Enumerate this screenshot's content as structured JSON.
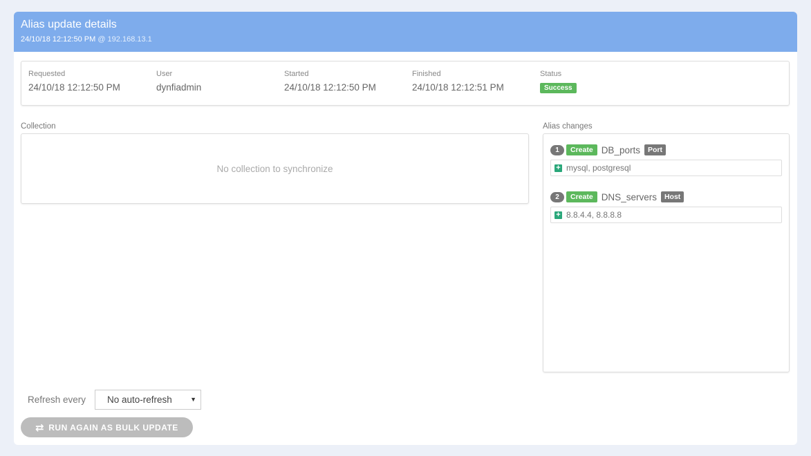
{
  "header": {
    "title": "Alias update details",
    "timestamp": "24/10/18 12:12:50 PM",
    "at": "@",
    "ip": "192.168.13.1"
  },
  "summary": {
    "requested_label": "Requested",
    "requested_value": "24/10/18 12:12:50 PM",
    "user_label": "User",
    "user_value": "dynfiadmin",
    "started_label": "Started",
    "started_value": "24/10/18 12:12:50 PM",
    "finished_label": "Finished",
    "finished_value": "24/10/18 12:12:51 PM",
    "status_label": "Status",
    "status_value": "Success"
  },
  "collection": {
    "label": "Collection",
    "empty_text": "No collection to synchronize"
  },
  "alias_changes": {
    "label": "Alias changes",
    "items": [
      {
        "number": "1",
        "action": "Create",
        "name": "DB_ports",
        "type": "Port",
        "values": "mysql, postgresql"
      },
      {
        "number": "2",
        "action": "Create",
        "name": "DNS_servers",
        "type": "Host",
        "values": "8.8.4.4, 8.8.8.8"
      }
    ]
  },
  "footer": {
    "refresh_label": "Refresh every",
    "refresh_value": "No auto-refresh",
    "run_button_label": "RUN AGAIN AS BULK UPDATE"
  },
  "colors": {
    "header_bg": "#7eacec",
    "success": "#5cb85c",
    "add_icon": "#2aa77a"
  },
  "icons": {
    "add": "plus-square-icon",
    "run": "retweet-icon",
    "dropdown": "caret-down-icon"
  }
}
